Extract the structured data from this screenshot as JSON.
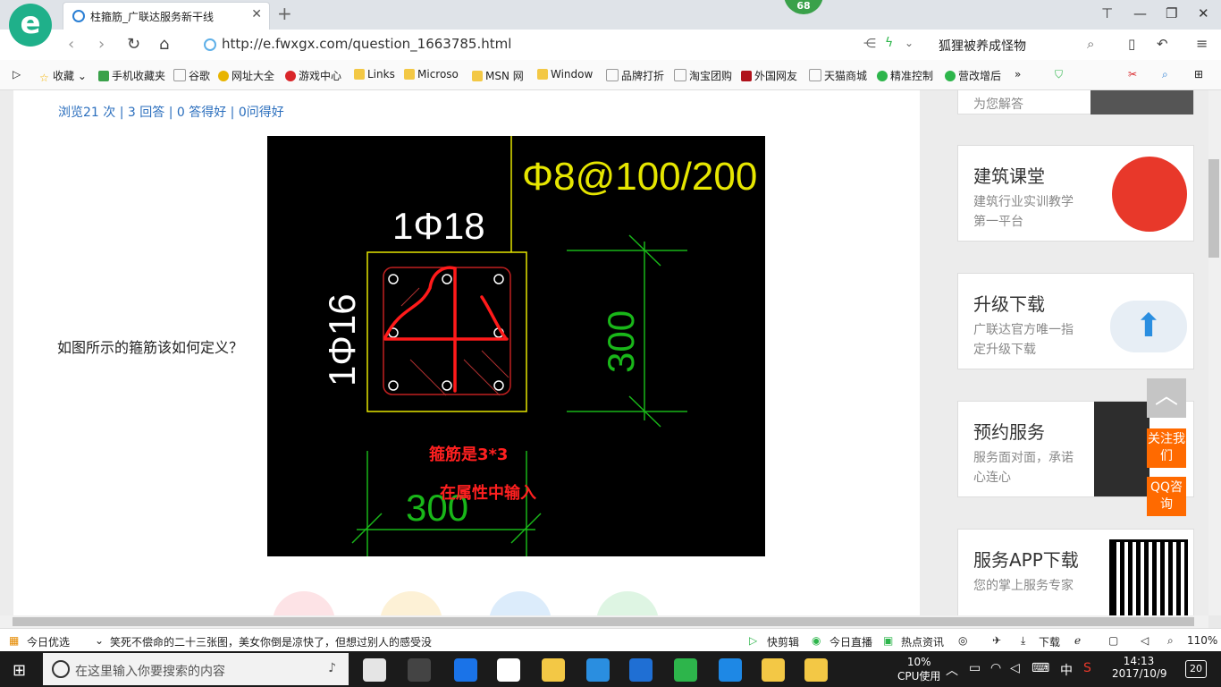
{
  "browser": {
    "tab_title": "柱箍筋_广联达服务新干线",
    "badge": "68",
    "url": "http://e.fwxgx.com/question_1663785.html",
    "search_text": "狐狸被养成怪物",
    "logo_letter": "e"
  },
  "bookmarks": [
    "收藏",
    "手机收藏夹",
    "谷歌",
    "网址大全",
    "游戏中心",
    "Links",
    "Microso",
    "MSN 网",
    "Window",
    "品牌打折",
    "淘宝团购",
    "外国网友",
    "天猫商城",
    "精准控制",
    "营改增后"
  ],
  "main": {
    "stats": "浏览21 次 | 3 回答 | 0 答得好 | 0问得好",
    "question": "如图所示的箍筋该如何定义？",
    "image": {
      "top_label": "Φ8@100/200",
      "left_label": "1Φ18",
      "side_label": "1Φ16",
      "dim_right": "300",
      "dim_bottom": "300",
      "note1": "箍筋是3*3",
      "note2": "在属性中输入"
    }
  },
  "sidebar": {
    "top_partial": "为您解答",
    "cards": [
      {
        "title": "建筑课堂",
        "desc": "建筑行业实训教学第一平台"
      },
      {
        "title": "升级下载",
        "desc": "广联达官方唯一指定升级下载"
      },
      {
        "title": "预约服务",
        "desc": "服务面对面，承诺心连心"
      },
      {
        "title": "服务APP下载",
        "desc": "您的掌上服务专家"
      }
    ],
    "follow_label": "关注我们",
    "qq_label": "QQ咨询"
  },
  "statusbar": {
    "left": "今日优选",
    "headline": "笑死不偿命的二十三张图，美女你倒是凉快了，但想过别人的感受没",
    "items": [
      "快剪辑",
      "今日直播",
      "热点资讯",
      "下载"
    ],
    "zoom": "110%"
  },
  "taskbar": {
    "search_placeholder": "在这里输入你要搜索的内容",
    "cpu_percent": "10%",
    "cpu_label": "CPU使用",
    "ime": "中",
    "time": "14:13",
    "date": "2017/10/9",
    "notifications": "20"
  }
}
